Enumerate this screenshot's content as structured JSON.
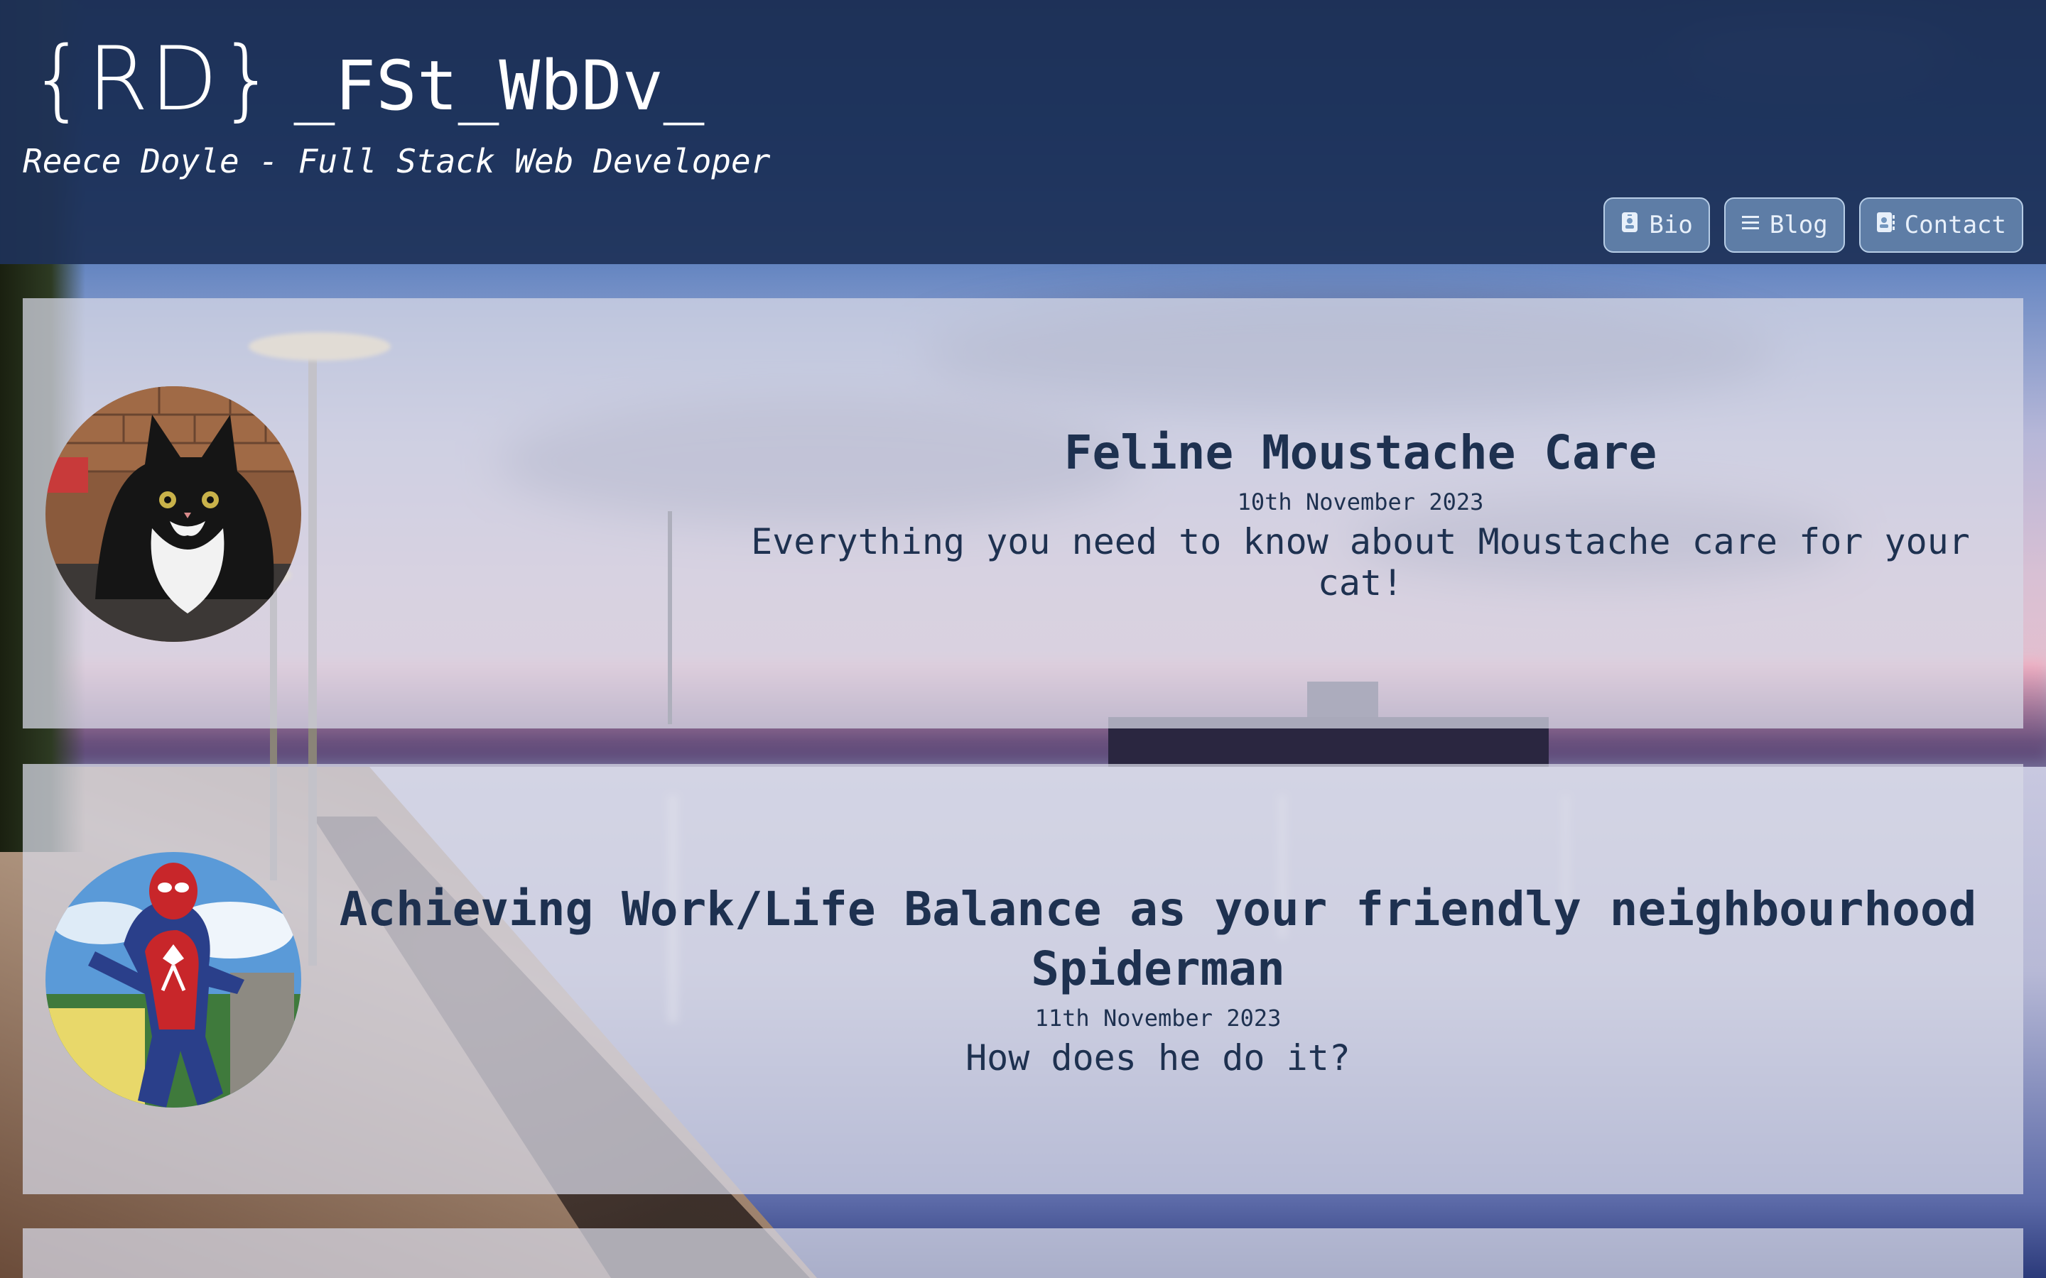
{
  "site": {
    "logo_mark": "{RD}",
    "logo_text": "_FSt_WbDv_",
    "tagline": "Reece Doyle - Full Stack Web Developer"
  },
  "nav": {
    "items": [
      {
        "label": "Bio",
        "icon": "id-badge-icon"
      },
      {
        "label": "Blog",
        "icon": "list-icon"
      },
      {
        "label": "Contact",
        "icon": "address-book-icon"
      }
    ]
  },
  "posts": [
    {
      "title": "Feline Moustache Care",
      "date": "10th November 2023",
      "description": "Everything you need to know about Moustache care for your cat!",
      "image": "black-and-white-cat-photo"
    },
    {
      "title": "Achieving Work/Life Balance as your friendly neighbourhood Spiderman",
      "date": "11th November 2023",
      "description": "How does he do it?",
      "image": "spiderman-costume-photo"
    }
  ],
  "colors": {
    "header_bg": "#1e3258",
    "card_text": "#1e3150",
    "nav_button_bg": "#7396be"
  }
}
